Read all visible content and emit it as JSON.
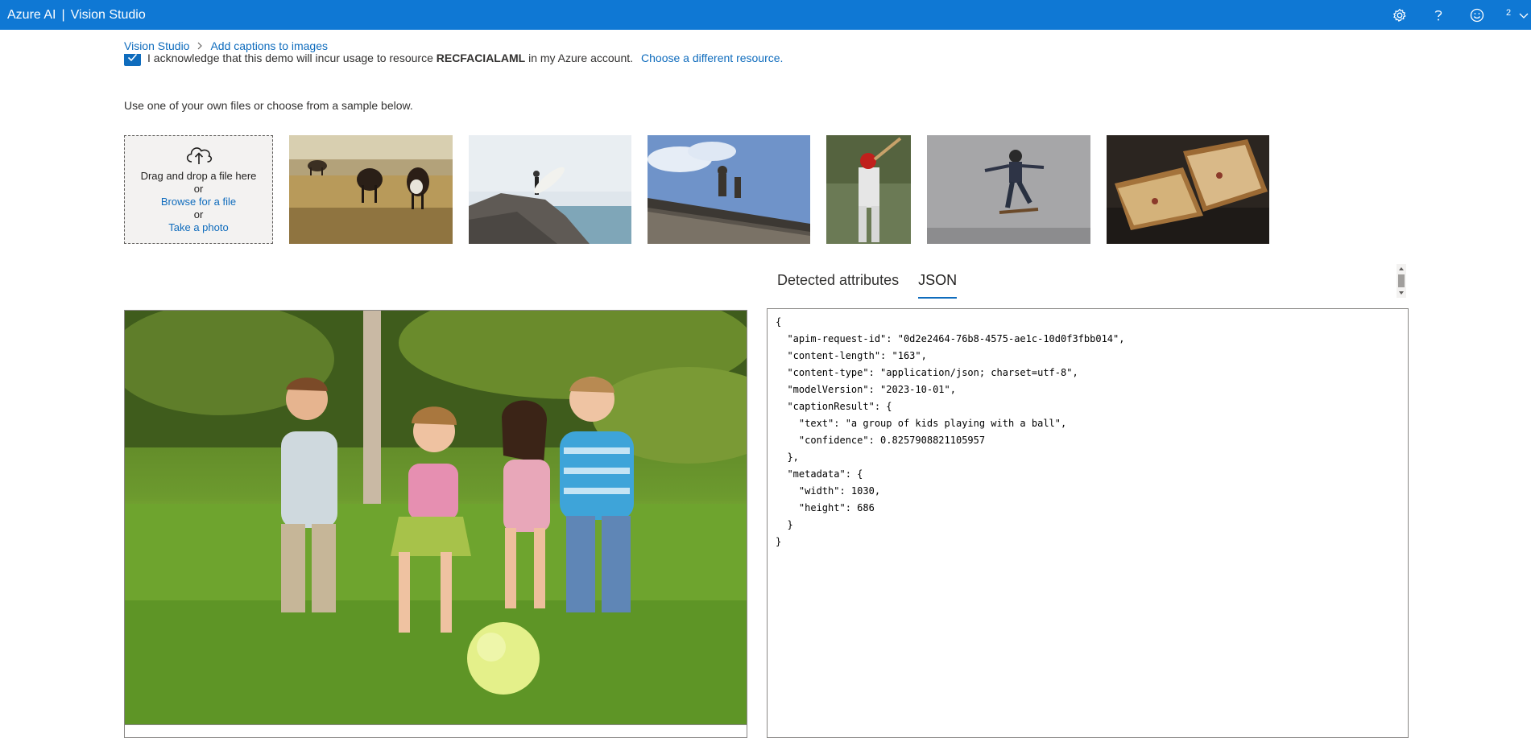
{
  "header": {
    "brand_left": "Azure AI",
    "brand_sep": "|",
    "brand_right": "Vision Studio",
    "user_initial": "2",
    "accent_color": "#0f78d4",
    "icons": [
      "gear-icon",
      "help-icon",
      "smiley-feedback-icon",
      "chevron-down-icon"
    ]
  },
  "breadcrumb": {
    "items": [
      "Vision Studio",
      "Add captions to images"
    ]
  },
  "acknowledgement": {
    "checked": true,
    "text_before": "I acknowledge that this demo will incur usage to resource",
    "resource": "RECFACIALAML",
    "text_after": "in my Azure account.",
    "link": "Choose a different resource."
  },
  "instruction": "Use one of your own files or choose from a sample below.",
  "dropzone": {
    "line1": "Drag and drop a file here",
    "or1": "or",
    "browse": "Browse for a file",
    "or2": "or",
    "photo": "Take a photo"
  },
  "samples": [
    "cows-grazing-image",
    "surfer-on-rock-image",
    "building-statues-image",
    "baseball-batter-image",
    "skateboarder-image",
    "grilled-sandwich-image"
  ],
  "tabs": [
    {
      "label": "Detected attributes",
      "active": false
    },
    {
      "label": "JSON",
      "active": true
    }
  ],
  "json_result": "{\n  \"apim-request-id\": \"0d2e2464-76b8-4575-ae1c-10d0f3fbb014\",\n  \"content-length\": \"163\",\n  \"content-type\": \"application/json; charset=utf-8\",\n  \"modelVersion\": \"2023-10-01\",\n  \"captionResult\": {\n    \"text\": \"a group of kids playing with a ball\",\n    \"confidence\": 0.8257908821105957\n  },\n  \"metadata\": {\n    \"width\": 1030,\n    \"height\": 686\n  }\n}"
}
